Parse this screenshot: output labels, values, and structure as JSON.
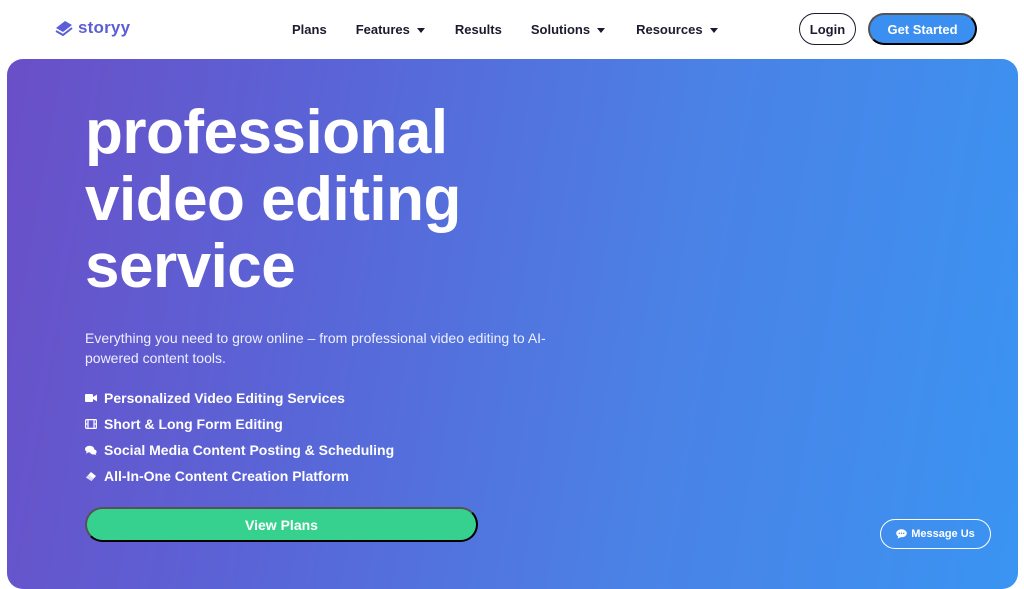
{
  "brand": {
    "name": "storyy"
  },
  "nav": {
    "items": [
      {
        "label": "Plans",
        "dropdown": false
      },
      {
        "label": "Features",
        "dropdown": true
      },
      {
        "label": "Results",
        "dropdown": false
      },
      {
        "label": "Solutions",
        "dropdown": true
      },
      {
        "label": "Resources",
        "dropdown": true
      }
    ],
    "login_label": "Login",
    "cta_label": "Get Started"
  },
  "hero": {
    "headline_lines": [
      "professional",
      "video editing",
      "service"
    ],
    "subtext": "Everything you need to grow online – from professional video editing to AI-powered content tools.",
    "features": [
      {
        "icon": "video-camera-icon",
        "label": "Personalized Video Editing Services"
      },
      {
        "icon": "film-icon",
        "label": "Short & Long Form Editing"
      },
      {
        "icon": "comments-icon",
        "label": "Social Media Content Posting & Scheduling"
      },
      {
        "icon": "eraser-icon",
        "label": "All-In-One Content Creation Platform"
      }
    ],
    "cta_label": "View Plans"
  },
  "chat": {
    "icon": "chat-bubble-icon",
    "label": "Message Us"
  },
  "colors": {
    "brand": "#5b5fd6",
    "primary_button": "#3b8ff0",
    "success_button": "#36d18e",
    "gradient_start": "#6a4fc8",
    "gradient_end": "#3a94f2"
  }
}
